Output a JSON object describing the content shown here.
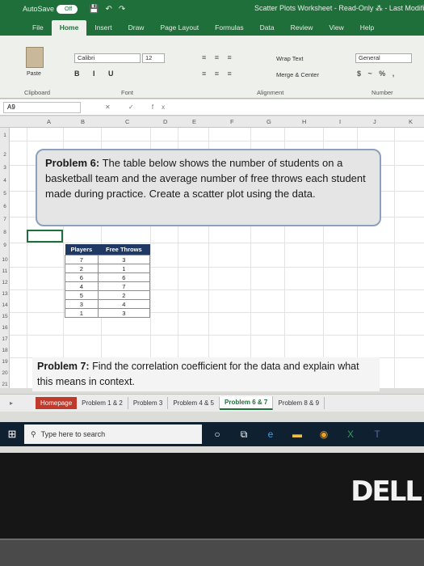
{
  "titlebar": {
    "autosave_label": "AutoSave",
    "autosave_state": "Off",
    "doc_title": "Scatter Plots Worksheet - Read-Only ⁂ - Last Modified"
  },
  "ribbon_tabs": [
    "File",
    "Home",
    "Insert",
    "Draw",
    "Page Layout",
    "Formulas",
    "Data",
    "Review",
    "View",
    "Help"
  ],
  "ribbon": {
    "paste_label": "Paste",
    "font_name": "Calibri",
    "font_size": "12",
    "font_buttons": "B I U",
    "align_row1": "≡ ≡ ≡",
    "align_row2": "≡ ≡ ≡",
    "wrap_text": "Wrap Text",
    "merge_center": "Merge & Center",
    "number_format": "General",
    "number_buttons": "$ ~ % ,",
    "groups": {
      "clipboard": "Clipboard",
      "font": "Font",
      "alignment": "Alignment",
      "number": "Number"
    }
  },
  "formula_bar": {
    "name_box": "A9",
    "fx_symbols": "✕ ✓ fx"
  },
  "columns": [
    "A",
    "B",
    "C",
    "D",
    "E",
    "F",
    "G",
    "H",
    "I",
    "J",
    "K"
  ],
  "rows": [
    "1",
    "2",
    "3",
    "4",
    "5",
    "6",
    "7",
    "8",
    "9",
    "10",
    "11",
    "12",
    "13",
    "14",
    "15",
    "16",
    "17",
    "18",
    "19",
    "20",
    "21"
  ],
  "problem6": {
    "label": "Problem 6:",
    "text": " The table below shows the number of students on a basketball team and the average number of free throws each student made during practice. Create a scatter plot using the data."
  },
  "table": {
    "headers": [
      "Players",
      "Free Throws"
    ],
    "rows": [
      [
        "7",
        "3"
      ],
      [
        "2",
        "1"
      ],
      [
        "6",
        "6"
      ],
      [
        "4",
        "7"
      ],
      [
        "5",
        "2"
      ],
      [
        "3",
        "4"
      ],
      [
        "1",
        "3"
      ]
    ]
  },
  "problem7": {
    "label": "Problem 7:",
    "text": " Find the correlation coefficient for the data and explain what this means in context."
  },
  "sheet_tabs": [
    "Homepage",
    "Problem 1 & 2",
    "Problem 3",
    "Problem 4 & 5",
    "Problem 6 & 7",
    "Problem 8 & 9"
  ],
  "active_sheet": "Problem 6 & 7",
  "taskbar": {
    "search_placeholder": "Type here to search"
  },
  "brand": "DELL",
  "colors": {
    "excel_green": "#1f6f3a",
    "header_navy": "#1f3864",
    "homepage_tab": "#c0392b"
  }
}
